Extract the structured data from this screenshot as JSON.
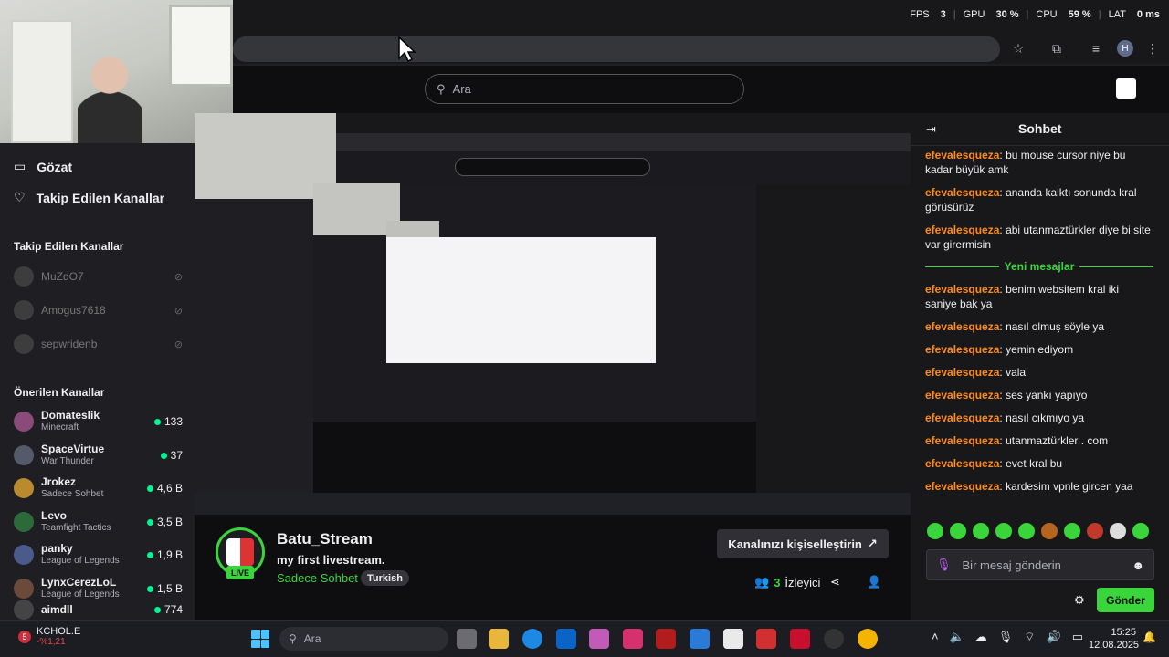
{
  "perf": {
    "fps_label": "FPS",
    "fps": "3",
    "gpu_label": "GPU",
    "gpu": "30 %",
    "cpu_label": "CPU",
    "cpu": "59 %",
    "lat_label": "LAT",
    "lat": "0 ms"
  },
  "browser": {
    "avatar": "H"
  },
  "search": {
    "placeholder": "Ara"
  },
  "sidebar": {
    "nav": [
      {
        "label": "Gözat"
      },
      {
        "label": "Takip Edilen Kanallar"
      }
    ],
    "followed_title": "Takip Edilen Kanallar",
    "followed": [
      {
        "name": "MuZdO7"
      },
      {
        "name": "Amogus7618"
      },
      {
        "name": "sepwridenb"
      }
    ],
    "recommended_title": "Önerilen Kanallar",
    "recommended": [
      {
        "name": "Domateslik",
        "game": "Minecraft",
        "viewers": "133"
      },
      {
        "name": "SpaceVirtue",
        "game": "War Thunder",
        "viewers": "37"
      },
      {
        "name": "Jrokez",
        "game": "Sadece Sohbet",
        "viewers": "4,6 B"
      },
      {
        "name": "Levo",
        "game": "Teamfight Tactics",
        "viewers": "3,5 B"
      },
      {
        "name": "panky",
        "game": "League of Legends",
        "viewers": "1,9 B"
      },
      {
        "name": "LynxCerezLoL",
        "game": "League of Legends",
        "viewers": "1,5 B"
      },
      {
        "name": "aimdll",
        "game": "",
        "viewers": "774"
      }
    ]
  },
  "channel": {
    "name": "Batu_Stream",
    "title": "my first livestream.",
    "category": "Sadece Sohbet",
    "tag": "Turkish",
    "live": "LIVE",
    "customize_label": "Kanalınızı kişiselleştirin",
    "viewer_count": "3",
    "viewer_label": "İzleyici"
  },
  "chat": {
    "title": "Sohbet",
    "divider": "Yeni mesajlar",
    "messages_before": [
      {
        "user": "efevalesqueza",
        "text": "bu mouse cursor niye bu kadar büyük amk"
      },
      {
        "user": "efevalesqueza",
        "text": "ananda kalktı sonunda kral görüsürüz"
      },
      {
        "user": "efevalesqueza",
        "text": "abi utanmaztürkler diye bi site var girermisin"
      }
    ],
    "messages_after": [
      {
        "user": "efevalesqueza",
        "text": "benim websitem kral iki saniye bak ya"
      },
      {
        "user": "efevalesqueza",
        "text": "nasıl olmuş söyle ya"
      },
      {
        "user": "efevalesqueza",
        "text": "yemin ediyom"
      },
      {
        "user": "efevalesqueza",
        "text": "vala"
      },
      {
        "user": "efevalesqueza",
        "text": "ses yankı yapıyo"
      },
      {
        "user": "efevalesqueza",
        "text": "nasıl cıkmıyo ya"
      },
      {
        "user": "efevalesqueza",
        "text": "utanmaztürkler . com"
      },
      {
        "user": "efevalesqueza",
        "text": "evet kral bu"
      },
      {
        "user": "efevalesqueza",
        "text": "kardesim vpnle gircen yaa"
      }
    ],
    "input_placeholder": "Bir mesaj gönderin",
    "send_label": "Gönder"
  },
  "taskbar": {
    "stock_badge": "5",
    "stock_name": "KCHOL.E",
    "stock_change": "-%1,21",
    "search_placeholder": "Ara",
    "time": "15:25",
    "date": "12.08.2025"
  },
  "colors": {
    "accent": "#3ad53a",
    "chat_user": "#ff8c1a",
    "background": "#0e0e10"
  }
}
